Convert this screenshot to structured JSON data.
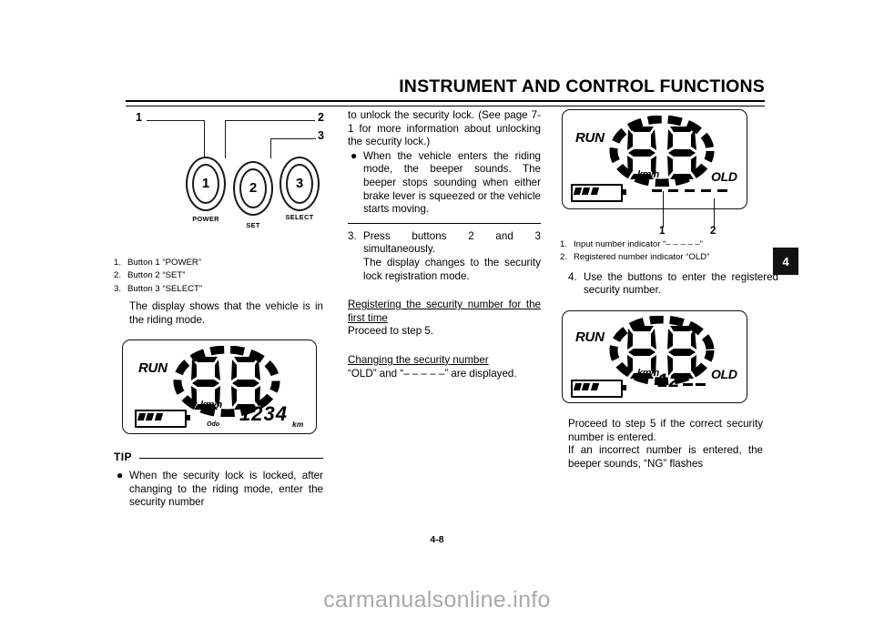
{
  "header": {
    "title": "INSTRUMENT AND CONTROL FUNCTIONS"
  },
  "page": {
    "number": "4-8",
    "chapter_tab": "4",
    "watermark": "carmanualsonline.info"
  },
  "button_figure": {
    "buttons": [
      {
        "digit": "1",
        "label": "POWER",
        "callout": "1"
      },
      {
        "digit": "2",
        "label": "SET",
        "callout": "2"
      },
      {
        "digit": "3",
        "label": "SELECT",
        "callout": "3"
      }
    ],
    "captions": [
      {
        "n": "1.",
        "text": "Button 1 “POWER”"
      },
      {
        "n": "2.",
        "text": "Button 2 “SET”"
      },
      {
        "n": "3.",
        "text": "Button 3 “SELECT”"
      }
    ]
  },
  "col1": {
    "intro": "The display shows that the vehicle is in the riding mode.",
    "lcd": {
      "run": "RUN",
      "speed": "00",
      "unit": "km/h",
      "odo_label": "Odo",
      "odo_value": "1234",
      "odo_unit": "km",
      "battery_bars": 3
    },
    "tip_label": "TIP",
    "tip_bullet": "When the security lock is locked, after changing to the riding mode, enter the security number"
  },
  "col2": {
    "continued": "to unlock the security lock. (See page 7-1 for more information about unlocking the security lock.)",
    "bullet": "When the vehicle enters the riding mode, the beeper sounds. The beeper stops sounding when either brake lever is squeezed or the vehicle starts moving.",
    "step3_num": "3.",
    "step3_text": "Press buttons 2 and 3 simultaneously.",
    "step3_more": "The display changes to the security lock registration mode.",
    "sub1_heading": "Registering the security number for the first time",
    "sub1_text": "Proceed to step 5.",
    "sub2_heading": "Changing the security number",
    "sub2_text": "“OLD” and “– – – – –” are displayed."
  },
  "col3": {
    "lcd_top": {
      "run": "RUN",
      "speed": "00",
      "unit": "km/h",
      "old": "OLD",
      "input_dashes": 5,
      "battery_bars": 3,
      "callouts": [
        "1",
        "2"
      ]
    },
    "captions": [
      {
        "n": "1.",
        "text": "Input number indicator “– – – – –”"
      },
      {
        "n": "2.",
        "text": "Registered number indicator “OLD”"
      }
    ],
    "step4_num": "4.",
    "step4_text": "Use the buttons to enter the registered security number.",
    "lcd_bottom": {
      "run": "RUN",
      "speed": "00",
      "unit": "km/h",
      "old": "OLD",
      "entered_digits": "12",
      "remaining_dashes": 2,
      "battery_bars": 3
    },
    "closing1": "Proceed to step 5 if the correct security number is entered.",
    "closing2": "If an incorrect number is entered, the beeper sounds, “NG” flashes"
  }
}
